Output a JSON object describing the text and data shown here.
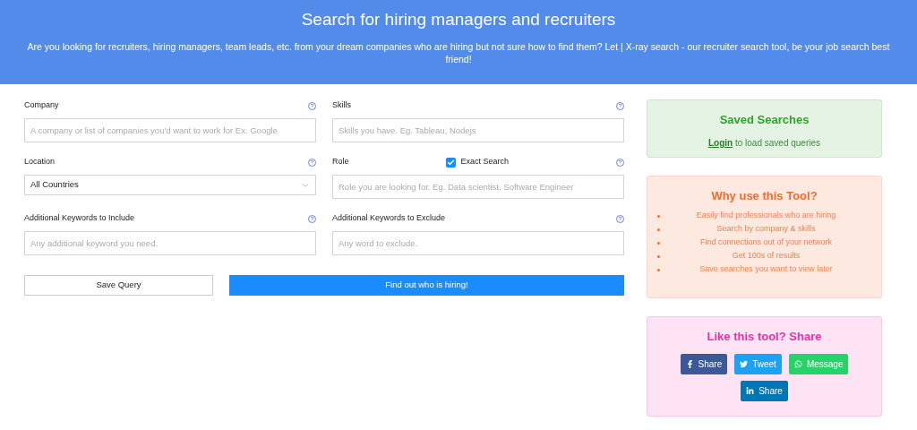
{
  "header": {
    "title": "Search for hiring managers and recruiters",
    "subtitle": "Are you looking for recruiters, hiring managers, team leads, etc. from your dream companies who are hiring but not sure how to find them? Let  | X-ray search - our recruiter search tool, be your job search best friend!"
  },
  "fields": [
    {
      "label": "Company",
      "kind": "input",
      "placeholder": "A company or list of companies you'd want to work for Ex. Google",
      "help": "?"
    },
    {
      "label": "Skills",
      "kind": "input",
      "placeholder": "Skills you have. Eg. Tableau, Nodejs",
      "help": "?"
    },
    {
      "label": "Location",
      "kind": "select",
      "value": "All Countries",
      "help": "?"
    },
    {
      "label": "Role",
      "kind": "input",
      "placeholder": "Role you are looking for. Eg. Data scientist, Software Engineer",
      "help": "?",
      "option": {
        "label": "Exact Search",
        "checked": true
      }
    },
    {
      "label": "Additional Keywords to Include",
      "kind": "input",
      "placeholder": "Any additional keyword you need.",
      "help": "?"
    },
    {
      "label": "Additional Keywords to Exclude",
      "kind": "input",
      "placeholder": "Any word to exclude.",
      "help": "?"
    }
  ],
  "buttons": {
    "save": "Save Query",
    "find": "Find out who is hiring!"
  },
  "saved": {
    "title": "Saved Searches",
    "link": "Login",
    "text": "to load saved queries"
  },
  "why": {
    "title": "Why use this Tool?",
    "items": [
      "Easily find professionals who are hiring",
      "Search by company & skills",
      "Find connections out of your network",
      "Get 100s of results",
      "Save searches you want to view later"
    ]
  },
  "share": {
    "title": "Like this tool? Share",
    "buttons": [
      {
        "kind": "facebook",
        "label": "Share",
        "color": "#3b5998"
      },
      {
        "kind": "twitter",
        "label": "Tweet",
        "color": "#1da1f2"
      },
      {
        "kind": "whatsapp",
        "label": "Message",
        "color": "#25d366"
      },
      {
        "kind": "linkedin",
        "label": "Share",
        "color": "#0077b5"
      }
    ]
  }
}
